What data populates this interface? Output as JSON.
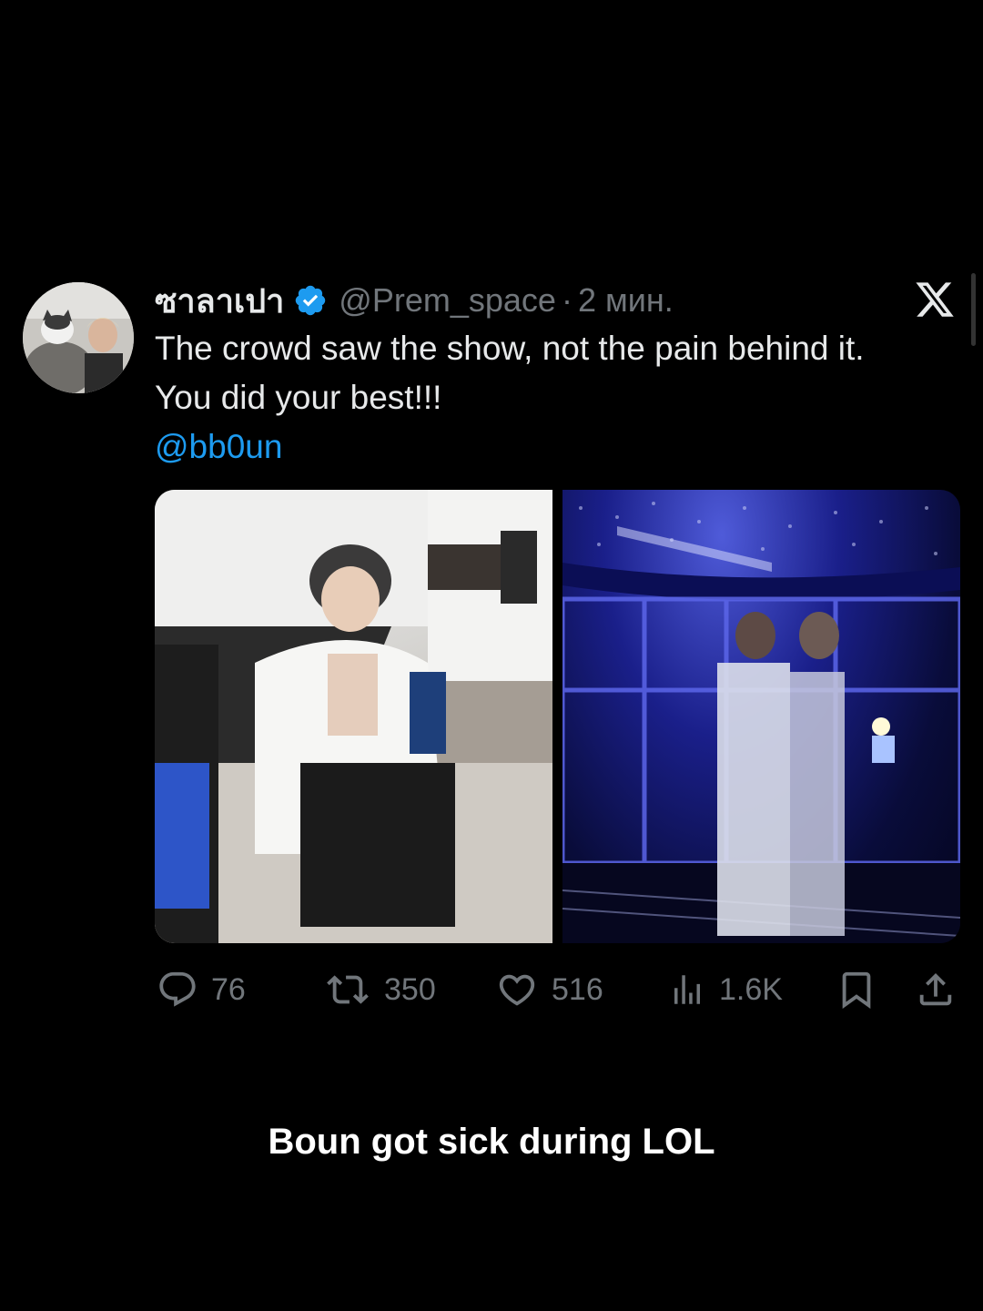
{
  "tweet": {
    "display_name": "ซาลาเปา",
    "handle": "@Prem_space",
    "separator": "·",
    "time": "2 мин.",
    "text_line1": "The crowd saw the show, not the pain behind it.",
    "text_line2": "You did your best!!!",
    "mention": "@bb0un",
    "media": [
      {
        "description": "backstage-photo"
      },
      {
        "description": "stage-photo"
      }
    ]
  },
  "actions": {
    "replies": "76",
    "reposts": "350",
    "likes": "516",
    "views": "1.6K"
  },
  "caption": "Boun got sick during LOL",
  "colors": {
    "background": "#000000",
    "text": "#e7e9ea",
    "muted": "#71767b",
    "accent": "#1d9bf0"
  },
  "icons": [
    "verified-badge-icon",
    "x-logo-icon",
    "reply-icon",
    "repost-icon",
    "like-icon",
    "views-icon",
    "bookmark-icon",
    "share-icon"
  ]
}
